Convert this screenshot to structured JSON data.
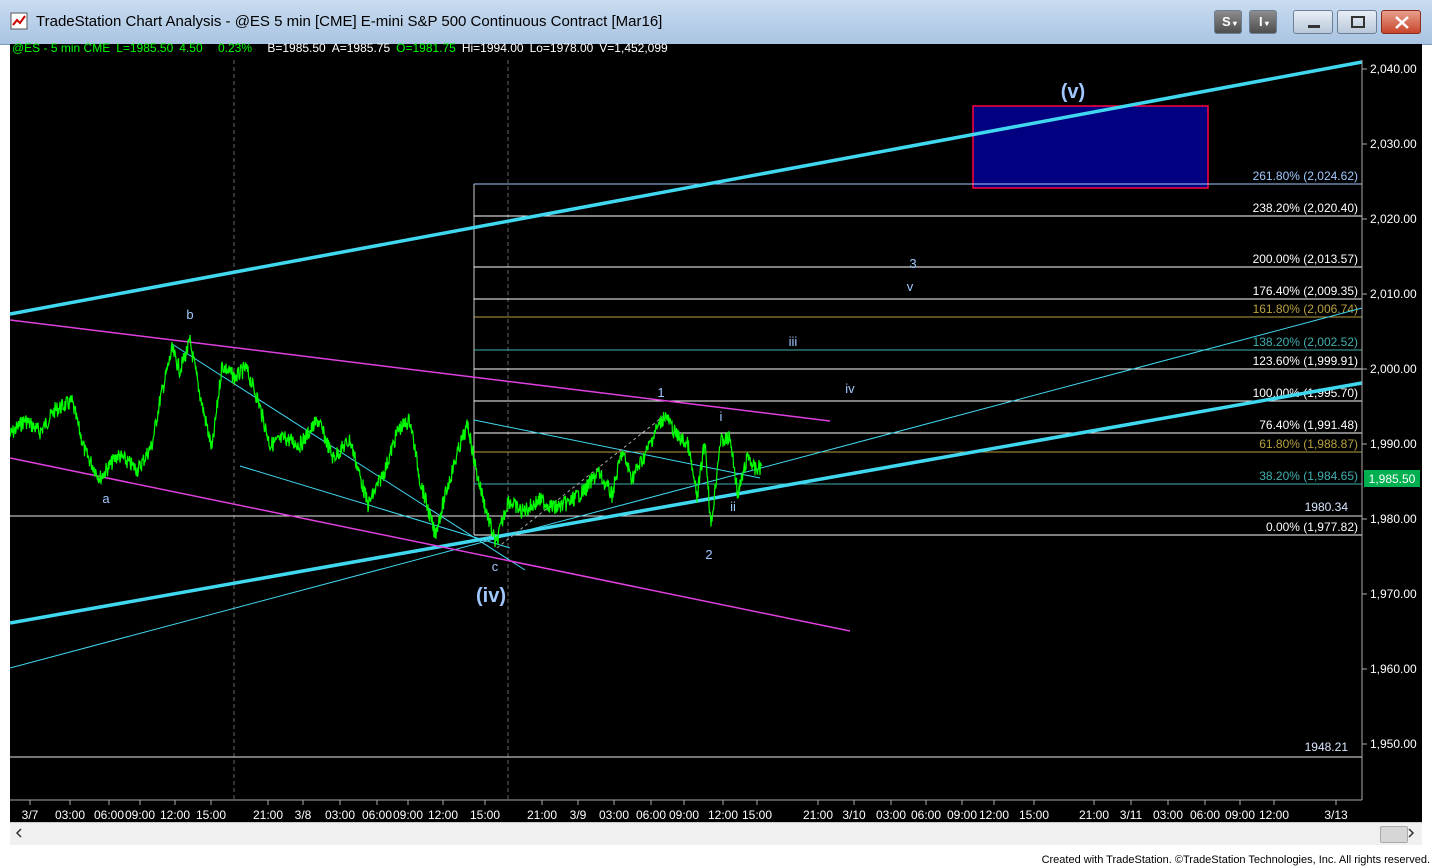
{
  "window": {
    "title": "TradeStation Chart Analysis - @ES 5 min [CME] E-mini S&P 500 Continuous Contract [Mar16]",
    "btn_s": "S",
    "btn_i": "I"
  },
  "status": {
    "symbol": "@ES - 5 min  CME",
    "last": "L=1985.50",
    "change": "4.50",
    "pct": "0.23%",
    "bid": "B=1985.50",
    "ask": "A=1985.75",
    "open": "O=1981.75",
    "high": "Hi=1994.00",
    "low": "Lo=1978.00",
    "volume": "V=1,452,099"
  },
  "price_axis": {
    "ticks": [
      "2,040.00",
      "2,030.00",
      "2,020.00",
      "2,010.00",
      "2,000.00",
      "1,990.00",
      "1,980.00",
      "1,970.00",
      "1,960.00",
      "1,950.00"
    ],
    "current": "1,985.50"
  },
  "time_axis": {
    "ticks": [
      "3/7",
      "03:00",
      "06:00",
      "09:00",
      "12:00",
      "15:00",
      "21:00",
      "3/8",
      "03:00",
      "06:00",
      "09:00",
      "12:00",
      "15:00",
      "21:00",
      "3/9",
      "03:00",
      "06:00",
      "09:00",
      "12:00",
      "15:00",
      "21:00",
      "3/10",
      "03:00",
      "06:00",
      "09:00",
      "12:00",
      "15:00",
      "21:00",
      "3/11",
      "03:00",
      "06:00",
      "09:00",
      "12:00",
      "3/13"
    ]
  },
  "fib_levels": [
    {
      "label": "261.80% (2,024.62)",
      "color": "#a0c8ff"
    },
    {
      "label": "238.20% (2,020.40)",
      "color": "#ffffff"
    },
    {
      "label": "200.00% (2,013.57)",
      "color": "#ffffff"
    },
    {
      "label": "176.40% (2,009.35)",
      "color": "#ffffff"
    },
    {
      "label": "161.80% (2,006.74)",
      "color": "#b8a040"
    },
    {
      "label": "138.20% (2,002.52)",
      "color": "#40b0b0"
    },
    {
      "label": "123.60% (1,999.91)",
      "color": "#ffffff"
    },
    {
      "label": "100.00% (1,995.70)",
      "color": "#ffffff"
    },
    {
      "label": "76.40% (1,991.48)",
      "color": "#ffffff"
    },
    {
      "label": "61.80% (1,988.87)",
      "color": "#b8a040"
    },
    {
      "label": "38.20% (1,984.65)",
      "color": "#40b0b0"
    },
    {
      "label": "0.00% (1,977.82)",
      "color": "#ffffff"
    }
  ],
  "price_lines": [
    "1980.34",
    "1948.21"
  ],
  "wave_labels": {
    "v_major": "(v)",
    "iv_major": "(iv)",
    "a": "a",
    "b": "b",
    "c": "c",
    "one": "1",
    "two": "2",
    "three": "3",
    "i": "i",
    "ii": "ii",
    "iii": "iii",
    "iv": "iv",
    "v": "v"
  },
  "footer": "Created with TradeStation. ©TradeStation Technologies, Inc. All rights reserved.",
  "colors": {
    "price": "#00ff00",
    "channel": "#40d8f0",
    "magenta": "#e040e0",
    "target_box": "#000080",
    "target_border": "#ff0040"
  }
}
